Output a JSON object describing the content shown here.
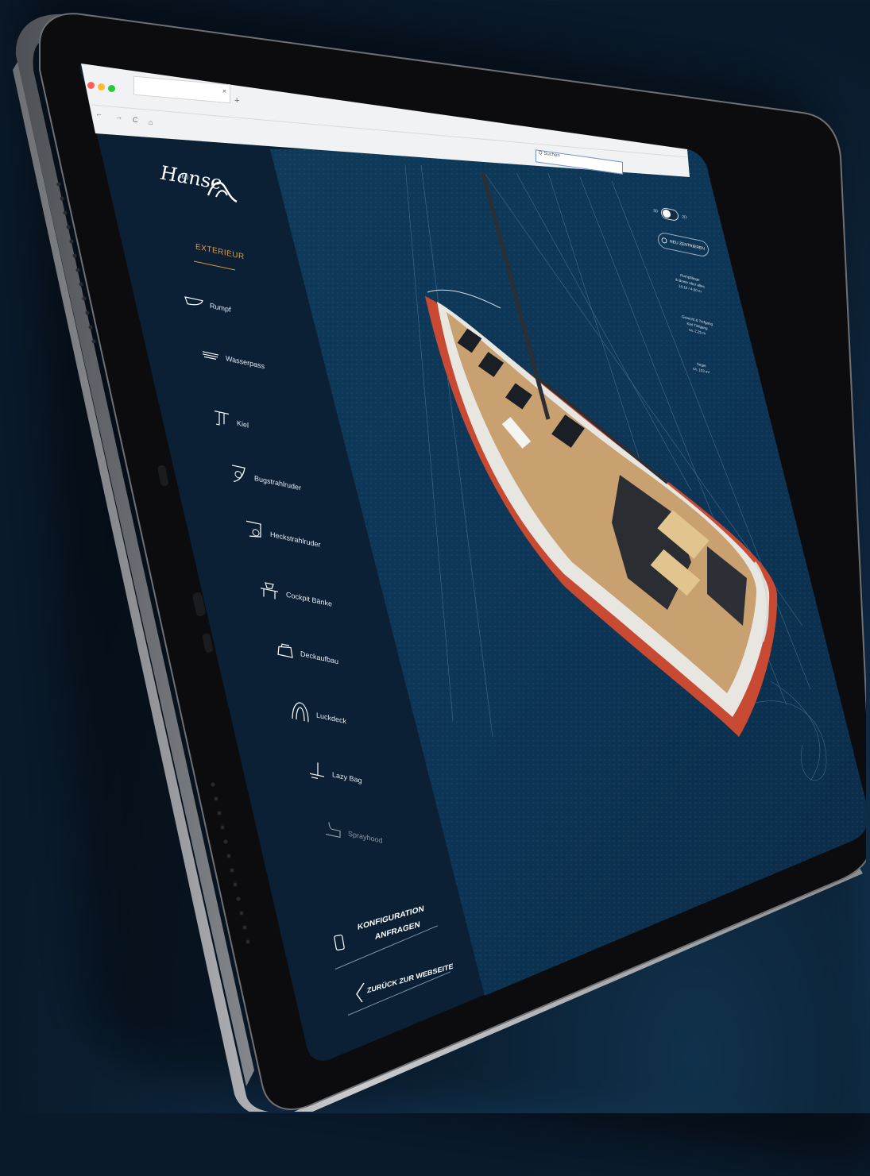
{
  "browser": {
    "tab_close": "×",
    "new_tab": "+",
    "nav_back": "←",
    "nav_forward": "→",
    "reload": "C",
    "home": "⌂",
    "url_field": "Q Suchen"
  },
  "brand": {
    "logo_text": "Hanse",
    "model_number": "460"
  },
  "sidebar": {
    "items": [
      {
        "label": "EXTERIEUR",
        "active": true,
        "icon": "none"
      },
      {
        "label": "Rumpf",
        "active": false,
        "icon": "hull-icon"
      },
      {
        "label": "Wasserpass",
        "active": false,
        "icon": "waterline-icon"
      },
      {
        "label": "Kiel",
        "active": false,
        "icon": "keel-icon"
      },
      {
        "label": "Bugstrahlruder",
        "active": false,
        "icon": "bow-thruster-icon"
      },
      {
        "label": "Heckstrahlruder",
        "active": false,
        "icon": "stern-thruster-icon"
      },
      {
        "label": "Cockpit Bänke",
        "active": false,
        "icon": "cockpit-bench-icon"
      },
      {
        "label": "Deckaufbau",
        "active": false,
        "icon": "deckhouse-icon"
      },
      {
        "label": "Luckdeck",
        "active": false,
        "icon": "hatch-icon"
      },
      {
        "label": "Lazy Bag",
        "active": false,
        "icon": "lazy-bag-icon"
      },
      {
        "label": "Sprayhood",
        "active": false,
        "icon": "sprayhood-icon"
      }
    ],
    "config_button": {
      "line1": "KONFIGURATION",
      "line2": "ANFRAGEN"
    },
    "back_button": "ZURÜCK ZUR WEBSEITE"
  },
  "viewer": {
    "toggle_left": "3D",
    "toggle_right": "2D",
    "center_button": "NEU ZENTRIEREN",
    "specs": [
      {
        "line1": "Rumpflänge",
        "line2": "& Breite über alles",
        "line3": "14,10 / 4,50 m"
      },
      {
        "line1": "Gewicht & Tiefgang",
        "line2": "Kiel Tiefgang",
        "line3": "ca. 2,25 m"
      },
      {
        "line1": "Segel",
        "line2": "ca. 103 m²"
      }
    ]
  },
  "colors": {
    "background": "#0a1a2b",
    "screen_sidebar": "#0b2035",
    "screen_main": "#0d3350",
    "accent_orange": "#e89a2f",
    "hull_red": "#c94a32",
    "teak": "#c9a070"
  }
}
